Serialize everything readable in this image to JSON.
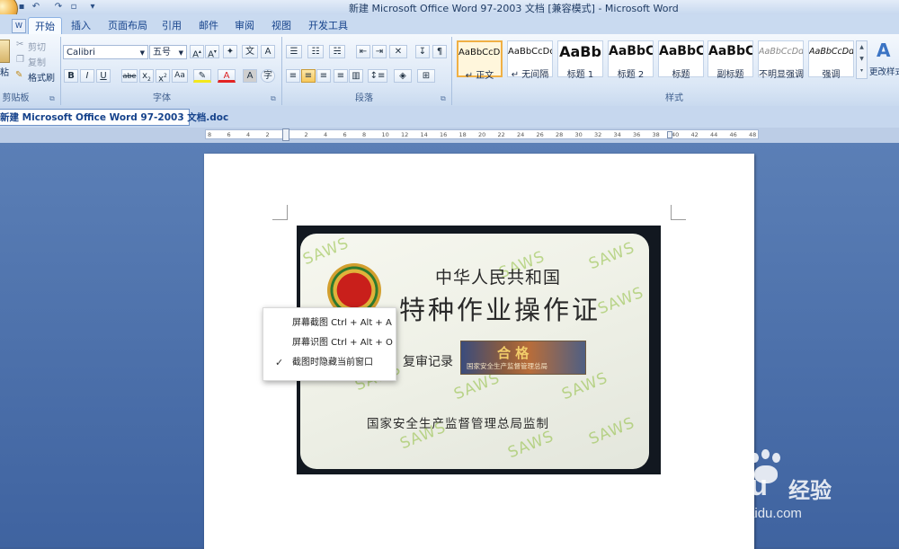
{
  "window": {
    "title": "新建 Microsoft Office Word 97-2003 文档 [兼容模式] - Microsoft Word"
  },
  "tabs": [
    {
      "label": "开始",
      "active": true
    },
    {
      "label": "插入"
    },
    {
      "label": "页面布局"
    },
    {
      "label": "引用"
    },
    {
      "label": "邮件"
    },
    {
      "label": "审阅"
    },
    {
      "label": "视图"
    },
    {
      "label": "开发工具"
    }
  ],
  "clipboard": {
    "paste_label": "粘",
    "cut": "剪切",
    "copy": "复制",
    "format_painter": "格式刷",
    "group_label": "剪贴板"
  },
  "font": {
    "name": "Calibri",
    "size": "五号",
    "group_label": "字体"
  },
  "paragraph": {
    "group_label": "段落"
  },
  "styles": {
    "group_label": "样式",
    "items": [
      {
        "sample": "AaBbCcDd",
        "name": "↵ 正文"
      },
      {
        "sample": "AaBbCcDd",
        "name": "↵ 无间隔"
      },
      {
        "sample": "AaBb",
        "name": "标题 1"
      },
      {
        "sample": "AaBbC",
        "name": "标题 2"
      },
      {
        "sample": "AaBbC",
        "name": "标题"
      },
      {
        "sample": "AaBbC",
        "name": "副标题"
      },
      {
        "sample": "AaBbCcDd",
        "name": "不明显强调"
      },
      {
        "sample": "AaBbCcDd",
        "name": "强调"
      }
    ],
    "change_styles": "更改样式"
  },
  "document_tab": {
    "label": "新建 Microsoft Office Word 97-2003 文档.doc"
  },
  "ruler": {
    "ticks": [
      "8",
      "6",
      "4",
      "2",
      "",
      "2",
      "4",
      "6",
      "8",
      "10",
      "12",
      "14",
      "16",
      "18",
      "20",
      "22",
      "24",
      "26",
      "28",
      "30",
      "32",
      "34",
      "36",
      "38",
      "40",
      "42",
      "44",
      "46",
      "48"
    ]
  },
  "card": {
    "line1": "中华人民共和国",
    "line2": "特种作业操作证",
    "review_label": "复审记录",
    "stamp_text": "合 格",
    "stamp_sub": "国家安全生产监督管理总局",
    "bottom": "国家安全生产监督管理总局监制",
    "watermark": "SAWS"
  },
  "context_menu": {
    "items": [
      {
        "label": "屏幕截图 Ctrl + Alt + A",
        "checked": false
      },
      {
        "label": "屏幕识图 Ctrl + Alt + O",
        "checked": false
      },
      {
        "label": "截图时隐藏当前窗口",
        "checked": true
      }
    ]
  },
  "watermark": {
    "brand": "Baidu",
    "brand_cn": "经验",
    "url": "jingyan.baidu.com"
  }
}
